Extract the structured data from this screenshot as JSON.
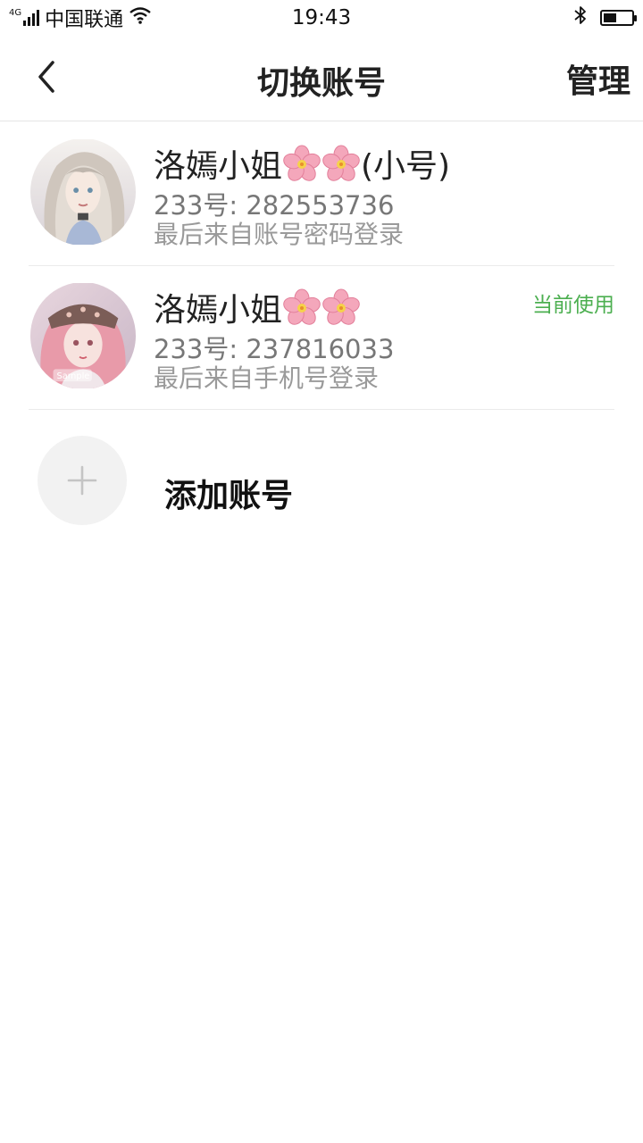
{
  "status_bar": {
    "network": "4G",
    "carrier": "中国联通",
    "time": "19:43",
    "battery_level": 0.45
  },
  "header": {
    "title": "切换账号",
    "manage_label": "管理"
  },
  "accounts": [
    {
      "name": "洛嫣小姐",
      "name_suffix": "(小号)",
      "id_line": "233号: 282553736",
      "login_method": "最后来自账号密码登录",
      "current": false
    },
    {
      "name": "洛嫣小姐",
      "name_suffix": "",
      "id_line": "233号: 237816033",
      "login_method": "最后来自手机号登录",
      "current": true,
      "current_label": "当前使用",
      "avatar_watermark": "Sample"
    }
  ],
  "add_account": {
    "label": "添加账号"
  },
  "colors": {
    "accent_green": "#4caf50",
    "divider": "#ebebeb",
    "add_bg": "#f2f2f2"
  },
  "icons": [
    "back-arrow-icon",
    "plus-icon",
    "bluetooth-icon",
    "wifi-icon",
    "signal-icon",
    "battery-icon",
    "cherry-blossom-icon"
  ]
}
